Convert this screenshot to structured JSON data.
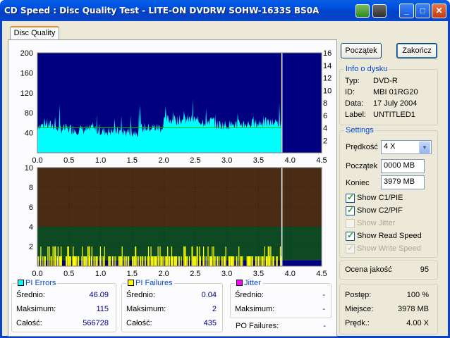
{
  "window": {
    "title": "CD Speed : Disc Quality Test - LITE-ON DVDRW SOHW-1633S BS0A",
    "minimize": "_",
    "maximize": "□",
    "close": "✕"
  },
  "tabs": [
    {
      "label": "Disc Quality",
      "active": true
    }
  ],
  "buttons": {
    "start": "Początek",
    "end": "Zakończ"
  },
  "info": {
    "title": "Info o dysku",
    "rows": [
      {
        "label": "Typ:",
        "value": "DVD-R"
      },
      {
        "label": "ID:",
        "value": "MBI 01RG20"
      },
      {
        "label": "Data:",
        "value": "17 July 2004"
      },
      {
        "label": "Label:",
        "value": "UNTITLED1"
      }
    ]
  },
  "settings": {
    "title": "Settings",
    "speed_label": "Prędkość",
    "speed_value": "4 X",
    "start_label": "Początek",
    "start_value": "0000 MB",
    "end_label": "Koniec",
    "end_value": "3979 MB",
    "checkboxes": [
      {
        "label": "Show C1/PIE",
        "checked": true,
        "enabled": true
      },
      {
        "label": "Show C2/PIF",
        "checked": true,
        "enabled": true
      },
      {
        "label": "Show Jitter",
        "checked": false,
        "enabled": false
      },
      {
        "label": "Show Read Speed",
        "checked": true,
        "enabled": true
      },
      {
        "label": "Show Write Speed",
        "checked": true,
        "enabled": false
      }
    ]
  },
  "quality": {
    "label": "Ocena jakość",
    "value": "95"
  },
  "progress": {
    "rows": [
      {
        "label": "Postęp:",
        "value": "100 %"
      },
      {
        "label": "Miejsce:",
        "value": "3978 MB"
      },
      {
        "label": "Prędk.:",
        "value": "4.00 X"
      }
    ]
  },
  "stats": {
    "pi_errors": {
      "title": "PI Errors",
      "color": "#00ffff",
      "avg_label": "Średnio:",
      "avg": "46.09",
      "max_label": "Maksimum:",
      "max": "115",
      "total_label": "Całość:",
      "total": "566728"
    },
    "pi_failures": {
      "title": "PI Failures",
      "color": "#ffff00",
      "avg_label": "Średnio:",
      "avg": "0.04",
      "max_label": "Maksimum:",
      "max": "2",
      "total_label": "Całość:",
      "total": "435"
    },
    "jitter": {
      "title": "Jitter",
      "color": "#ff00ff",
      "avg_label": "Średnio:",
      "avg": "-",
      "max_label": "Maksimum:",
      "max": "-",
      "po_label": "PO Failures:",
      "po": "-"
    }
  },
  "chart_data": [
    {
      "type": "area",
      "name": "PI Errors",
      "x_ticks": [
        "0.0",
        "0.5",
        "1.0",
        "1.5",
        "2.0",
        "2.5",
        "3.0",
        "3.5",
        "4.0",
        "4.5"
      ],
      "xlim": [
        0,
        4.5
      ],
      "y_left_ticks": [
        "40",
        "80",
        "120",
        "160",
        "200"
      ],
      "ylim_left": [
        0,
        200
      ],
      "y_right_ticks": [
        "2",
        "4",
        "6",
        "8",
        "10",
        "12",
        "14",
        "16"
      ],
      "ylim_right": [
        0,
        16
      ],
      "background": "#000080",
      "fill_color": "#00ffff",
      "read_speed_color": "#00c000",
      "end_x": 3.86,
      "segments": [
        {
          "x0": 0.0,
          "x1": 0.3,
          "y": 55
        },
        {
          "x0": 0.3,
          "x1": 0.6,
          "y": 48
        },
        {
          "x0": 0.6,
          "x1": 1.0,
          "y": 46
        },
        {
          "x0": 1.0,
          "x1": 1.3,
          "y": 43
        },
        {
          "x0": 1.3,
          "x1": 1.6,
          "y": 42
        },
        {
          "x0": 1.6,
          "x1": 2.0,
          "y": 50
        },
        {
          "x0": 2.0,
          "x1": 2.5,
          "y": 66
        },
        {
          "x0": 2.5,
          "x1": 2.8,
          "y": 63
        },
        {
          "x0": 2.8,
          "x1": 3.2,
          "y": 56
        },
        {
          "x0": 3.2,
          "x1": 3.5,
          "y": 58
        },
        {
          "x0": 3.5,
          "x1": 3.86,
          "y": 60
        }
      ],
      "read_speed_y": 4.0
    },
    {
      "type": "bar",
      "name": "PI Failures",
      "x_ticks": [
        "0.0",
        "0.5",
        "1.0",
        "1.5",
        "2.0",
        "2.5",
        "3.0",
        "3.5",
        "4.0",
        "4.5"
      ],
      "xlim": [
        0,
        4.5
      ],
      "y_ticks": [
        "2",
        "4",
        "6",
        "8",
        "10"
      ],
      "ylim": [
        0,
        10
      ],
      "bar_color": "#ffff00",
      "end_x": 3.86
    }
  ]
}
